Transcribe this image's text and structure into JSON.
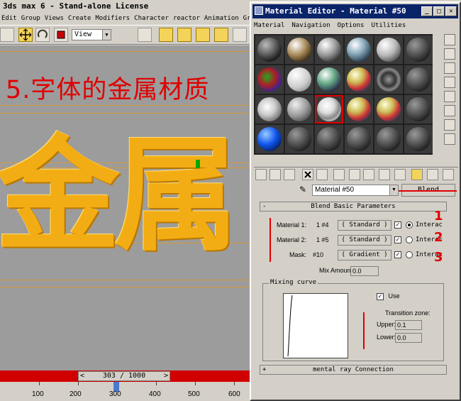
{
  "main": {
    "title": "3ds max 6 - Stand-alone License",
    "menu": [
      "Edit",
      "Group",
      "Views",
      "Create",
      "Modifiers",
      "Character",
      "reactor",
      "Animation",
      "Graph"
    ],
    "view_select": "View",
    "overlay_note": "5.字体的金属材质",
    "viewport_text": "金属",
    "time_slider": {
      "value": "303 / 1000",
      "prev": "<",
      "next": ">"
    },
    "track_ticks": [
      "100",
      "200",
      "300",
      "400",
      "500",
      "600"
    ]
  },
  "me": {
    "title": "Material Editor - Material #50",
    "menu": [
      "Material",
      "Navigation",
      "Options",
      "Utilities"
    ],
    "material_name": "Material #50",
    "material_type": "Blend",
    "rollout_title": "Blend Basic Parameters",
    "rows": [
      {
        "label": "Material 1:",
        "name": "1 #4",
        "button": "( Standard )",
        "interactive": "Interac"
      },
      {
        "label": "Material 2:",
        "name": "1 #5",
        "button": "( Standard )",
        "interactive": "Interac"
      },
      {
        "label": "Mask:",
        "name": "#10",
        "button": "( Gradient )",
        "interactive": "Interac"
      }
    ],
    "mix_amount_label": "Mix Amount:",
    "mix_amount_value": "0.0",
    "mixing_curve_title": "Mixing curve",
    "use_label": "Use",
    "transition_zone": "Transition zone:",
    "upper_label": "Upper:",
    "upper_value": "0.1",
    "lower_label": "Lower:",
    "lower_value": "0.0",
    "mental_ray": "mental ray Connection",
    "annotation_numbers": [
      "1",
      "2",
      "3"
    ]
  },
  "colors": {
    "accent_red": "#e00000",
    "title_blue": "#0a246a",
    "gold": "#f3ad14"
  }
}
